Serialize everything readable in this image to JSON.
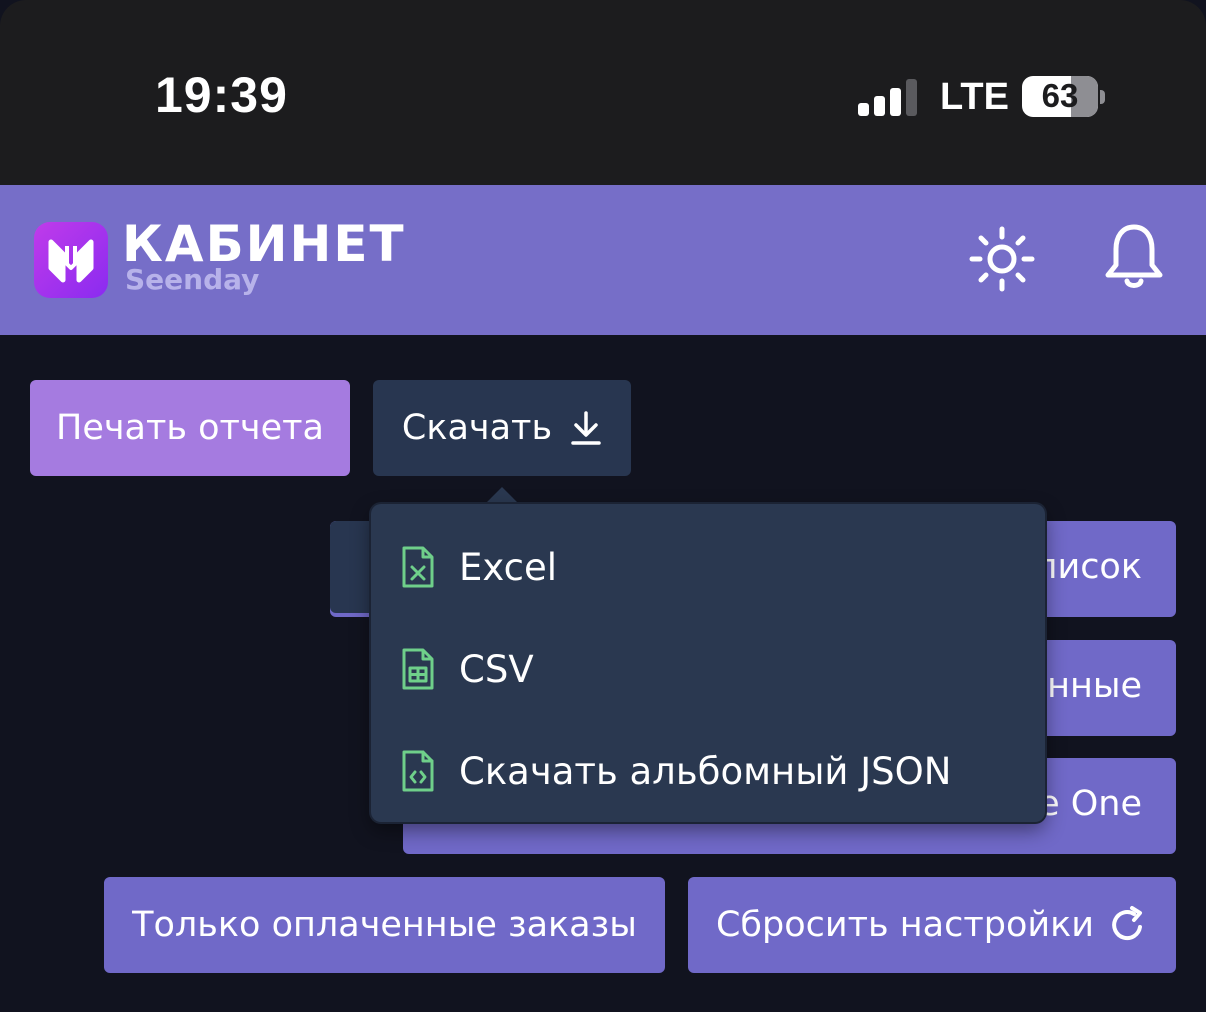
{
  "status_bar": {
    "time": "19:39",
    "network": "LTE",
    "battery": "63",
    "battery_level": 0.63
  },
  "header": {
    "brand_title": "КАБИНЕТ",
    "brand_subtitle": "Seenday",
    "icons": [
      "theme-sun-icon",
      "notification-bell-icon"
    ]
  },
  "toolbar": {
    "print_label": "Печать отчета",
    "download_label": "Скачать",
    "paid_only_label": "Только оплаченные заказы",
    "reset_label": "Сбросить настройки"
  },
  "obscured_buttons": {
    "row1_suffix": "писок",
    "row2_suffix": "нные",
    "row3_suffix": "e One"
  },
  "download_menu": {
    "items": [
      {
        "label": "Excel",
        "icon": "excel-file-icon"
      },
      {
        "label": "CSV",
        "icon": "csv-file-icon"
      },
      {
        "label": "Скачать альбомный JSON",
        "icon": "json-file-icon"
      }
    ]
  },
  "colors": {
    "header_bg": "#766ec8",
    "page_bg": "#11131f",
    "accent_button": "#a57be0",
    "button": "#7069c8",
    "menu_bg": "#2a3850",
    "file_icon": "#6fcf8a"
  }
}
